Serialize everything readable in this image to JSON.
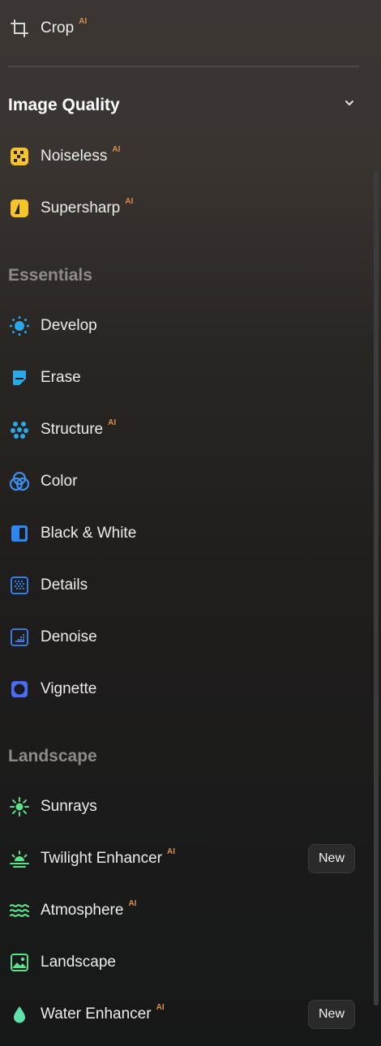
{
  "crop": {
    "label": "Crop",
    "ai": "AI"
  },
  "image_quality": {
    "title": "Image Quality",
    "items": [
      {
        "label": "Noiseless",
        "ai": "AI",
        "icon": "noiseless-icon"
      },
      {
        "label": "Supersharp",
        "ai": "AI",
        "icon": "supersharp-icon"
      }
    ]
  },
  "essentials": {
    "title": "Essentials",
    "items": [
      {
        "label": "Develop",
        "icon": "develop-sun-icon"
      },
      {
        "label": "Erase",
        "icon": "erase-icon"
      },
      {
        "label": "Structure",
        "ai": "AI",
        "icon": "structure-icon"
      },
      {
        "label": "Color",
        "icon": "color-circles-icon"
      },
      {
        "label": "Black & White",
        "icon": "black-white-icon"
      },
      {
        "label": "Details",
        "icon": "details-icon"
      },
      {
        "label": "Denoise",
        "icon": "denoise-icon"
      },
      {
        "label": "Vignette",
        "icon": "vignette-icon"
      }
    ]
  },
  "landscape": {
    "title": "Landscape",
    "items": [
      {
        "label": "Sunrays",
        "icon": "sunrays-icon"
      },
      {
        "label": "Twilight Enhancer",
        "ai": "AI",
        "badge": "New",
        "icon": "twilight-icon"
      },
      {
        "label": "Atmosphere",
        "ai": "AI",
        "icon": "atmosphere-icon"
      },
      {
        "label": "Landscape",
        "icon": "landscape-icon"
      },
      {
        "label": "Water Enhancer",
        "ai": "AI",
        "badge": "New",
        "icon": "water-drop-icon"
      }
    ]
  },
  "colors": {
    "ai_tag": "#d6904e",
    "image_quality_accent": "#f5c32c",
    "essentials_accent": "#2aa8e8",
    "landscape_accent": "#5fe08a"
  }
}
